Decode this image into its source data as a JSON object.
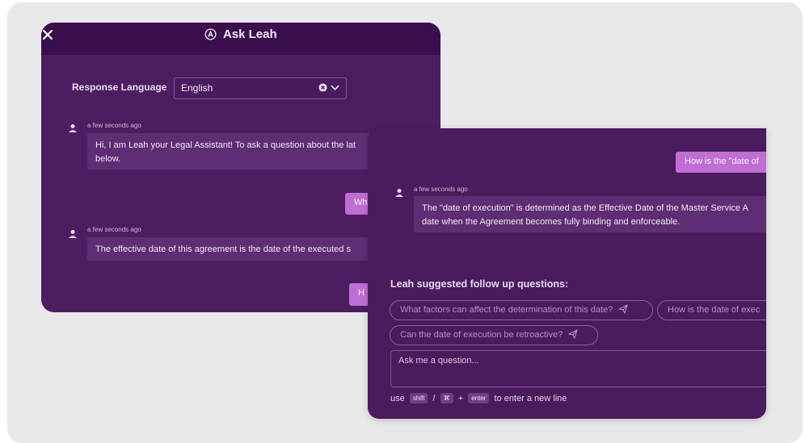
{
  "app": {
    "title": "Ask Leah"
  },
  "settings": {
    "language_label": "Response Language",
    "language_value": "English"
  },
  "back_chat": {
    "messages": [
      {
        "timestamp": "a few seconds ago",
        "text_line1": "Hi, I am Leah your Legal Assistant! To ask a question about the lat",
        "text_line2": "below."
      },
      {
        "timestamp": "a few seconds ago",
        "text": "The effective date of this agreement is the date of the executed s"
      }
    ],
    "user_bubbles": [
      "Wh",
      "H"
    ]
  },
  "front_chat": {
    "user_question": "How is the \"date of",
    "answer_timestamp": "a few seconds ago",
    "answer_line1": "The \"date of execution\" is determined as the Effective Date of the Master Service A",
    "answer_line2": "date when the Agreement becomes fully binding and enforceable.",
    "followup_title": "Leah suggested follow up questions:",
    "suggestions": [
      "What factors can affect the determination of this date?",
      "How is the date of exec",
      "Can the date of execution be retroactive?"
    ],
    "input_placeholder": "Ask me a question...",
    "hint": {
      "use": "use",
      "shift": "shift",
      "slash": "/",
      "cmd": "⌘",
      "plus": "+",
      "enter": "enter",
      "suffix": "to enter a new line"
    }
  },
  "colors": {
    "panel": "#4a1b5d",
    "header": "#3b0f4e",
    "user_bubble": "#c06ed3",
    "chip_text": "#b88fcd"
  },
  "icons": [
    "close-icon",
    "leah-logo-icon",
    "clear-icon",
    "chevron-down-icon",
    "user-avatar-icon",
    "send-icon"
  ]
}
